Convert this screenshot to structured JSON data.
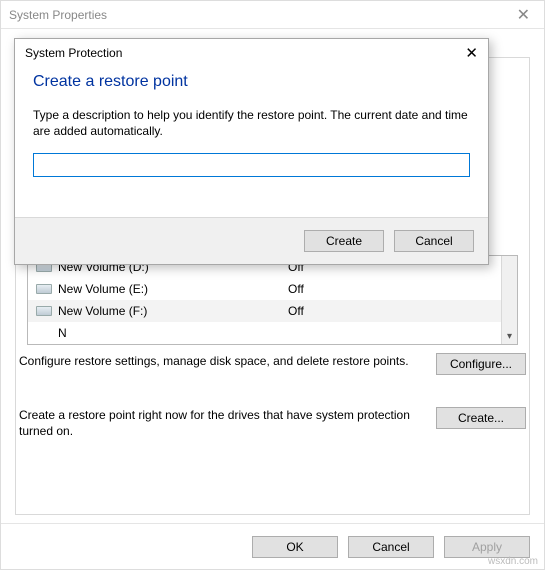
{
  "parent": {
    "title": "System Properties",
    "ok": "OK",
    "cancel": "Cancel",
    "apply": "Apply"
  },
  "drives": [
    {
      "name": "New Volume (D:)",
      "protection": "Off"
    },
    {
      "name": "New Volume (E:)",
      "protection": "Off"
    },
    {
      "name": "New Volume (F:)",
      "protection": "Off"
    },
    {
      "name": "",
      "protection": ""
    }
  ],
  "prefixCut": "N",
  "configure": {
    "text": "Configure restore settings, manage disk space, and delete restore points.",
    "button": "Configure..."
  },
  "create": {
    "text": "Create a restore point right now for the drives that have system protection turned on.",
    "button": "Create..."
  },
  "dialog": {
    "title": "System Protection",
    "heading": "Create a restore point",
    "desc": "Type a description to help you identify the restore point. The current date and time are added automatically.",
    "value": "",
    "create": "Create",
    "cancel": "Cancel"
  },
  "watermark": "wsxdn.com"
}
